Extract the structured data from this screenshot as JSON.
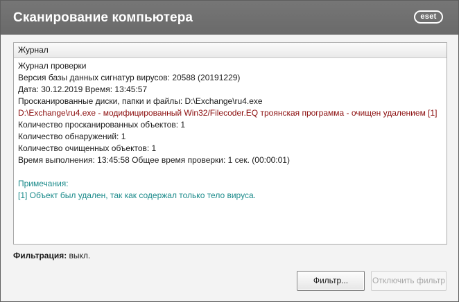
{
  "window": {
    "title": "Сканирование компьютера",
    "brand": "eset"
  },
  "log": {
    "header": "Журнал",
    "lines": [
      {
        "text": "Журнал проверки",
        "kind": "normal"
      },
      {
        "text": "Версия базы данных сигнатур вирусов: 20588 (20191229)",
        "kind": "normal"
      },
      {
        "text": "Дата: 30.12.2019  Время: 13:45:57",
        "kind": "normal"
      },
      {
        "text": "Просканированные диски, папки и файлы: D:\\Exchange\\ru4.exe",
        "kind": "normal"
      },
      {
        "text": "D:\\Exchange\\ru4.exe - модифицированный Win32/Filecoder.EQ троянская программа - очищен удалением [1]",
        "kind": "threat"
      },
      {
        "text": "Количество просканированных объектов: 1",
        "kind": "normal"
      },
      {
        "text": "Количество обнаружений: 1",
        "kind": "normal"
      },
      {
        "text": "Количество очищенных объектов: 1",
        "kind": "normal"
      },
      {
        "text": "Время выполнения: 13:45:58  Общее время проверки: 1 сек. (00:00:01)",
        "kind": "normal"
      },
      {
        "text": "",
        "kind": "blank"
      },
      {
        "text": "Примечания:",
        "kind": "note"
      },
      {
        "text": "[1] Объект был удален, так как содержал только тело вируса.",
        "kind": "note"
      }
    ]
  },
  "filter": {
    "label": "Фильтрация:",
    "value": "выкл."
  },
  "buttons": {
    "filter": "Фильтр...",
    "disable_filter": "Отключить фильтр"
  },
  "colors": {
    "titlebar": "#6f6f6f",
    "threat_text": "#8b0d0d",
    "note_text": "#1a8a8a"
  }
}
